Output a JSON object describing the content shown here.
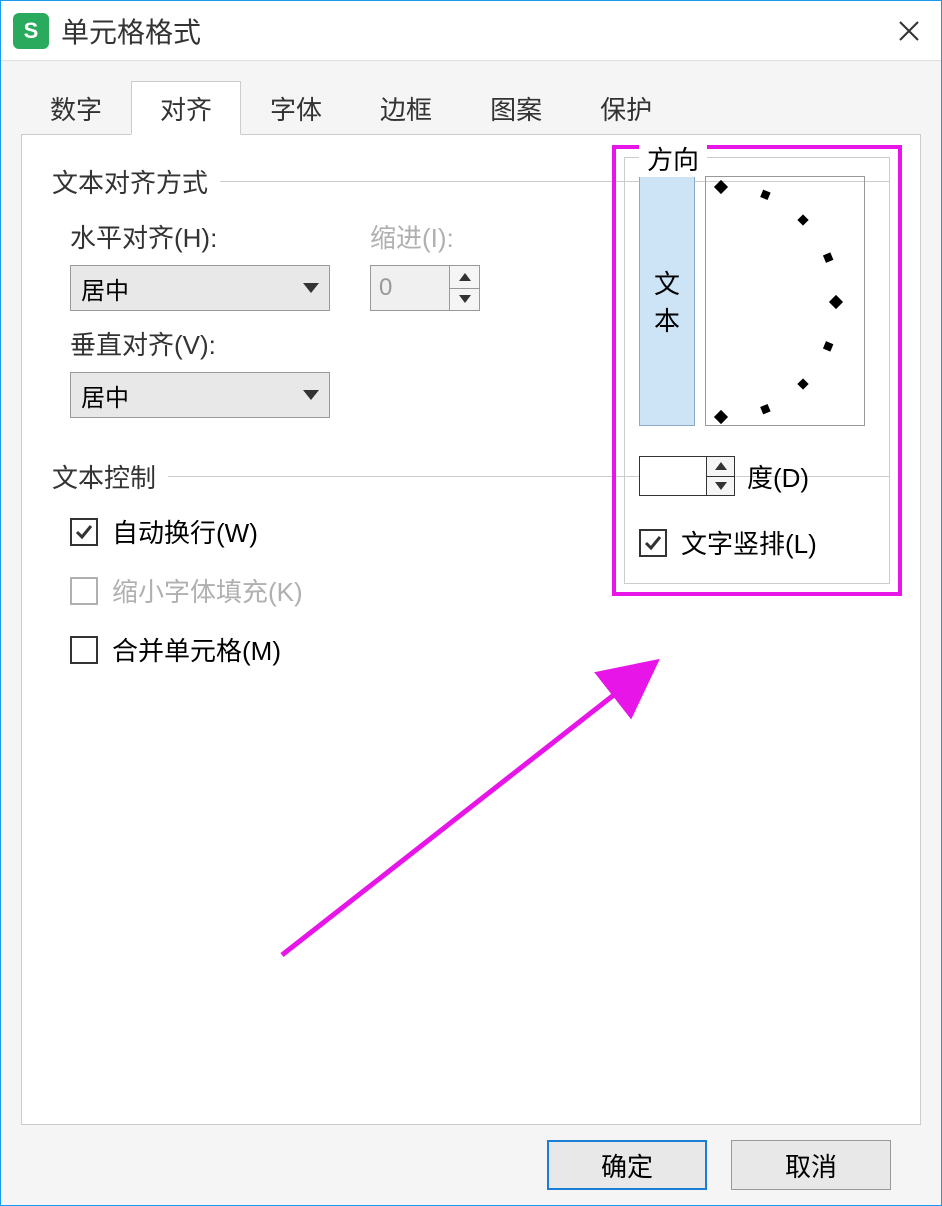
{
  "window": {
    "title": "单元格格式",
    "app_icon_letter": "S"
  },
  "tabs": {
    "items": [
      "数字",
      "对齐",
      "字体",
      "边框",
      "图案",
      "保护"
    ],
    "active_index": 1
  },
  "alignment": {
    "section_label": "文本对齐方式",
    "horizontal_label": "水平对齐(H):",
    "horizontal_value": "居中",
    "indent_label": "缩进(I):",
    "indent_value": "0",
    "vertical_label": "垂直对齐(V):",
    "vertical_value": "居中"
  },
  "text_control": {
    "section_label": "文本控制",
    "wrap_label": "自动换行(W)",
    "wrap_checked": true,
    "shrink_label": "缩小字体填充(K)",
    "shrink_checked": false,
    "shrink_disabled": true,
    "merge_label": "合并单元格(M)",
    "merge_checked": false
  },
  "orientation": {
    "legend": "方向",
    "text_sample": "文本",
    "degree_value": "",
    "degree_label": "度(D)",
    "vertical_text_label": "文字竖排(L)",
    "vertical_text_checked": true
  },
  "footer": {
    "ok": "确定",
    "cancel": "取消"
  }
}
